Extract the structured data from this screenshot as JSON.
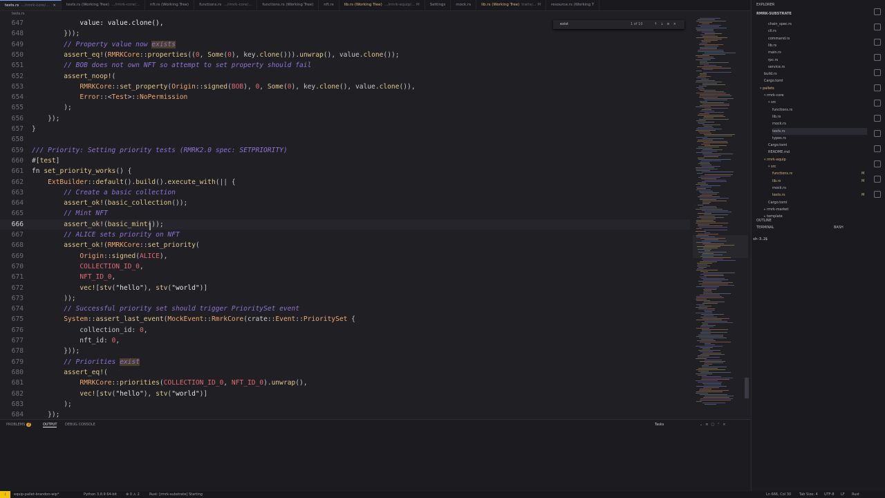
{
  "tabs": [
    {
      "name": "tests.rs",
      "desc": ".../rmrk-core/...",
      "active": true,
      "mod": false,
      "close": "×"
    },
    {
      "name": "tests.rs (Working Tree)",
      "desc": ".../rmrk-core/...",
      "mod": false
    },
    {
      "name": "nft.rs (Working Tree)",
      "desc": "",
      "mod": false
    },
    {
      "name": "functions.rs",
      "desc": ".../rmrk-core/...",
      "mod": false
    },
    {
      "name": "functions.rs (Working Tree)",
      "desc": "",
      "mod": false
    },
    {
      "name": "nft.rs",
      "desc": "",
      "mod": false
    },
    {
      "name": "lib.rs (Working Tree)",
      "desc": ".../rmrk-equip/... M",
      "mod": true
    },
    {
      "name": "Settings",
      "desc": "",
      "mod": false
    },
    {
      "name": "mock.rs",
      "desc": "",
      "mod": false
    },
    {
      "name": "lib.rs (Working Tree)",
      "desc": "traits/... M",
      "mod": true
    },
    {
      "name": "resource.rs (Working T",
      "desc": "",
      "mod": false
    }
  ],
  "breadcrumb": "tests.rs",
  "find": {
    "query": "exist",
    "count": "1 of 10",
    "buttons": "↑↓≡×"
  },
  "code_lines": [
    {
      "n": "647",
      "html": "            <span class='st'>value: value.clone(),</span>"
    },
    {
      "n": "648",
      "html": "        }));"
    },
    {
      "n": "649",
      "html": "        <span class='c'>// Property value now <span class='hl'>exists</span></span>"
    },
    {
      "n": "650",
      "html": "        <span class='fn'>assert_eq!</span>(<span class='ty'>RMRKCore</span>::<span class='fn'>properties</span>((<span class='cn'>0</span>, <span class='fn'>Some</span>(<span class='cn'>0</span>), key.<span class='fn'>clone</span>())).<span class='fn'>unwrap</span>(), value.<span class='fn'>clone</span>());"
    },
    {
      "n": "651",
      "html": "        <span class='c'>// BOB does not own NFT so attempt to set property should fail</span>"
    },
    {
      "n": "652",
      "html": "        <span class='fn'>assert_noop!</span>("
    },
    {
      "n": "653",
      "html": "            <span class='ty'>RMRKCore</span>::<span class='fn'>set_property</span>(<span class='ty'>Origin</span>::<span class='fn'>signed</span>(<span class='cn'>BOB</span>), <span class='cn'>0</span>, <span class='fn'>Some</span>(<span class='cn'>0</span>), key.<span class='fn'>clone</span>(), value.<span class='fn'>clone</span>()),"
    },
    {
      "n": "654",
      "html": "            <span class='ty'>Error</span>::&lt;<span class='ty'>Test</span>&gt;::<span class='ty'>NoPermission</span>"
    },
    {
      "n": "655",
      "html": "        );"
    },
    {
      "n": "656",
      "html": "    });"
    },
    {
      "n": "657",
      "html": "}"
    },
    {
      "n": "658",
      "html": ""
    },
    {
      "n": "659",
      "html": "<span class='c'>/// Priority: Setting priority tests (RMRK2.0 spec: SETPRIORITY)</span>"
    },
    {
      "n": "660",
      "html": "#[<span class='fn'>test</span>]"
    },
    {
      "n": "661",
      "html": "<span class='k'>fn</span> <span class='fn'>set_priority_works</span>() {"
    },
    {
      "n": "662",
      "html": "    <span class='ty'>ExtBuilder</span>::<span class='fn'>default</span>().<span class='fn'>build</span>().<span class='fn'>execute_with</span>(|| {"
    },
    {
      "n": "663",
      "html": "        <span class='c'>// Create a basic collection</span>"
    },
    {
      "n": "664",
      "html": "        <span class='fn'>assert_ok!</span>(<span class='fn'>basic_collection</span>());"
    },
    {
      "n": "665",
      "html": "        <span class='c'>// Mint NFT</span>"
    },
    {
      "n": "666",
      "html": "        <span class='fn'>assert_ok!</span>(<span class='fn'>basic_mint</span>());",
      "current": true
    },
    {
      "n": "667",
      "html": "        <span class='c'>// ALICE sets priority on NFT</span>"
    },
    {
      "n": "668",
      "html": "        <span class='fn'>assert_ok!</span>(<span class='ty'>RMRKCore</span>::<span class='fn'>set_priority</span>("
    },
    {
      "n": "669",
      "html": "            <span class='ty'>Origin</span>::<span class='fn'>signed</span>(<span class='cn'>ALICE</span>),"
    },
    {
      "n": "670",
      "html": "            <span class='cn'>COLLECTION_ID_0</span>,"
    },
    {
      "n": "671",
      "html": "            <span class='cn'>NFT_ID_0</span>,"
    },
    {
      "n": "672",
      "html": "            <span class='fn'>vec!</span>[<span class='fn'>stv</span>(<span class='st'>\"hello\"</span>), <span class='fn'>stv</span>(<span class='st'>\"world\"</span>)]"
    },
    {
      "n": "673",
      "html": "        ));"
    },
    {
      "n": "674",
      "html": "        <span class='c'>// Successful priority set should trigger PrioritySet event</span>"
    },
    {
      "n": "675",
      "html": "        <span class='ty'>System</span>::<span class='fn'>assert_last_event</span>(<span class='ty'>MockEvent</span>::<span class='ty'>RmrkCore</span>(crate::<span class='ty'>Event</span>::<span class='ty'>PrioritySet</span> {"
    },
    {
      "n": "676",
      "html": "            collection_id: <span class='cn'>0</span>,"
    },
    {
      "n": "677",
      "html": "            nft_id: <span class='cn'>0</span>,"
    },
    {
      "n": "678",
      "html": "        }));"
    },
    {
      "n": "679",
      "html": "        <span class='c'>// Priorities <span class='hl'>exist</span></span>"
    },
    {
      "n": "680",
      "html": "        <span class='fn'>assert_eq!</span>("
    },
    {
      "n": "681",
      "html": "            <span class='ty'>RMRKCore</span>::<span class='fn'>priorities</span>(<span class='cn'>COLLECTION_ID_0</span>, <span class='cn'>NFT_ID_0</span>).<span class='fn'>unwrap</span>(),"
    },
    {
      "n": "682",
      "html": "            <span class='fn'>vec!</span>[<span class='fn'>stv</span>(<span class='st'>\"hello\"</span>), <span class='fn'>stv</span>(<span class='st'>\"world\"</span>)]"
    },
    {
      "n": "683",
      "html": "        );"
    },
    {
      "n": "684",
      "html": "    });"
    }
  ],
  "sidebar": {
    "title": "EXPLORER",
    "root": "RMRK-SUBSTRATE",
    "outline": "OUTLINE",
    "terminal": "TERMINAL",
    "terminal_shell": "BASH",
    "terminal_prompt": "sh-3.2$",
    "items": [
      {
        "label": "chain_spec.rs",
        "depth": 2,
        "kind": "file"
      },
      {
        "label": "cli.rs",
        "depth": 2,
        "kind": "file"
      },
      {
        "label": "command.rs",
        "depth": 2,
        "kind": "file"
      },
      {
        "label": "lib.rs",
        "depth": 2,
        "kind": "file"
      },
      {
        "label": "main.rs",
        "depth": 2,
        "kind": "file"
      },
      {
        "label": "rpc.rs",
        "depth": 2,
        "kind": "file"
      },
      {
        "label": "service.rs",
        "depth": 2,
        "kind": "file"
      },
      {
        "label": "build.rs",
        "depth": 1,
        "kind": "file"
      },
      {
        "label": "Cargo.toml",
        "depth": 1,
        "kind": "file"
      },
      {
        "label": "pallets",
        "depth": 0,
        "kind": "dir",
        "mod": true
      },
      {
        "label": "rmrk-core",
        "depth": 1,
        "kind": "dir"
      },
      {
        "label": "src",
        "depth": 2,
        "kind": "dir"
      },
      {
        "label": "functions.rs",
        "depth": 3,
        "kind": "file"
      },
      {
        "label": "lib.rs",
        "depth": 3,
        "kind": "file"
      },
      {
        "label": "mock.rs",
        "depth": 3,
        "kind": "file"
      },
      {
        "label": "tests.rs",
        "depth": 3,
        "kind": "file",
        "sel": true
      },
      {
        "label": "types.rs",
        "depth": 3,
        "kind": "file"
      },
      {
        "label": "Cargo.toml",
        "depth": 2,
        "kind": "file"
      },
      {
        "label": "README.md",
        "depth": 2,
        "kind": "file"
      },
      {
        "label": "rmrk-equip",
        "depth": 1,
        "kind": "dir",
        "mod": true
      },
      {
        "label": "src",
        "depth": 2,
        "kind": "dir",
        "mod": true
      },
      {
        "label": "functions.rs",
        "depth": 3,
        "kind": "file",
        "mod": true,
        "badge": "M"
      },
      {
        "label": "lib.rs",
        "depth": 3,
        "kind": "file",
        "mod": true,
        "badge": "M"
      },
      {
        "label": "mock.rs",
        "depth": 3,
        "kind": "file"
      },
      {
        "label": "tests.rs",
        "depth": 3,
        "kind": "file",
        "mod": true,
        "badge": "M"
      },
      {
        "label": "Cargo.toml",
        "depth": 2,
        "kind": "file"
      },
      {
        "label": "rmrk-market",
        "depth": 1,
        "kind": "cdir"
      },
      {
        "label": "template",
        "depth": 1,
        "kind": "cdir"
      }
    ]
  },
  "panel": {
    "tabs": [
      "PROBLEMS",
      "OUTPUT",
      "DEBUG CONSOLE"
    ],
    "problems_count": "2",
    "dropdown": "Tasks"
  },
  "statusbar": {
    "remote": "⟩",
    "branch": "equip-pallet-brandon-wip*",
    "python": "Python 3.8.9 64-bit",
    "errors": "⊗ 0 ⚠ 2",
    "rust": "Rust: [rmrk-substrate] Starting",
    "position": "Ln 666, Col 30",
    "tabsize": "Tab Size: 4",
    "encoding": "UTF-8",
    "eol": "LF",
    "language": "Rust"
  }
}
